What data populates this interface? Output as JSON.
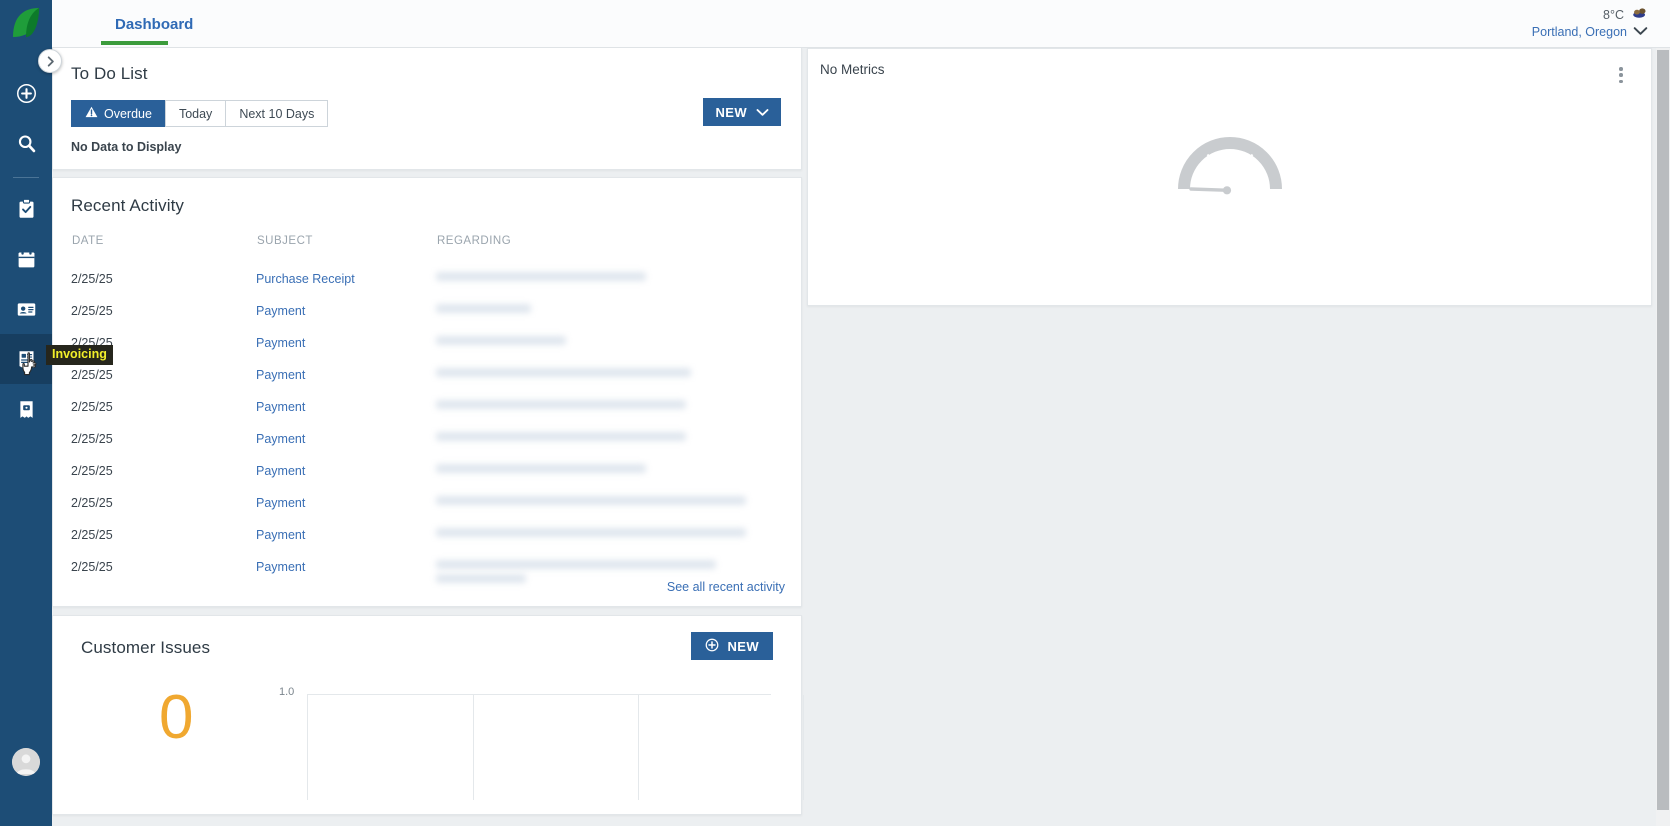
{
  "app": {
    "logo_icon": "leaf-logo-icon",
    "accent_blue": "#2a6099",
    "rail_bg": "#1d4d76",
    "tab_underline_green": "#3c9c3c",
    "link_blue": "#3a6fb5",
    "orange": "#f0a830"
  },
  "rail": {
    "toggle_icon": "chevron-right-icon",
    "items": [
      {
        "icon": "plus-circle-icon",
        "name": "create"
      },
      {
        "icon": "search-icon",
        "name": "search"
      },
      {
        "icon": "clipboard-check-icon",
        "name": "tasks"
      },
      {
        "icon": "calendar-icon",
        "name": "calendar"
      },
      {
        "icon": "contact-card-icon",
        "name": "contacts"
      },
      {
        "icon": "invoice-icon",
        "name": "invoicing"
      },
      {
        "icon": "receipt-icon",
        "name": "receipts"
      }
    ],
    "active_item": "invoicing",
    "tooltip": "Invoicing",
    "avatar_icon": "user-avatar-icon"
  },
  "header": {
    "tab_label": "Dashboard",
    "weather": {
      "temperature": "8°C",
      "icon": "weather-icon",
      "location": "Portland, Oregon",
      "chevron_icon": "chevron-down-icon"
    }
  },
  "todo": {
    "title": "To Do List",
    "filters": [
      {
        "label": "Overdue",
        "selected": true,
        "icon": "warning-triangle-icon"
      },
      {
        "label": "Today",
        "selected": false,
        "icon": ""
      },
      {
        "label": "Next 10 Days",
        "selected": false,
        "icon": ""
      }
    ],
    "new_button": "NEW",
    "new_button_icon": "chevron-down-icon",
    "empty_message": "No Data to Display"
  },
  "recent_activity": {
    "title": "Recent Activity",
    "columns": [
      "DATE",
      "SUBJECT",
      "REGARDING"
    ],
    "rows": [
      {
        "date": "2/25/25",
        "subject": "Purchase Receipt",
        "regarding": "",
        "redacted": true,
        "lines": 1
      },
      {
        "date": "2/25/25",
        "subject": "Payment",
        "regarding": "",
        "redacted": true,
        "lines": 1
      },
      {
        "date": "2/25/25",
        "subject": "Payment",
        "regarding": "",
        "redacted": true,
        "lines": 1
      },
      {
        "date": "2/25/25",
        "subject": "Payment",
        "regarding": "",
        "redacted": true,
        "lines": 1
      },
      {
        "date": "2/25/25",
        "subject": "Payment",
        "regarding": "",
        "redacted": true,
        "lines": 1
      },
      {
        "date": "2/25/25",
        "subject": "Payment",
        "regarding": "",
        "redacted": true,
        "lines": 1
      },
      {
        "date": "2/25/25",
        "subject": "Payment",
        "regarding": "",
        "redacted": true,
        "lines": 1
      },
      {
        "date": "2/25/25",
        "subject": "Payment",
        "regarding": "",
        "redacted": true,
        "lines": 1
      },
      {
        "date": "2/25/25",
        "subject": "Payment",
        "regarding": "",
        "redacted": true,
        "lines": 1
      },
      {
        "date": "2/25/25",
        "subject": "Payment",
        "regarding": "",
        "redacted": true,
        "lines": 2
      }
    ],
    "see_all_link": "See all recent activity"
  },
  "customer_issues": {
    "title": "Customer Issues",
    "new_button": "NEW",
    "new_button_icon": "plus-circle-icon",
    "count": "0",
    "chart_y_top_label": "1.0"
  },
  "metrics": {
    "title": "No Metrics",
    "menu_icon": "kebab-menu-icon",
    "placeholder_icon": "gauge-icon"
  },
  "chart_data": {
    "type": "bar",
    "title": "Customer Issues",
    "categories": [],
    "values": [],
    "series": [
      {
        "name": "Customer Issues",
        "values": []
      }
    ],
    "ylabel": "",
    "xlabel": "",
    "ylim": [
      0,
      1.0
    ],
    "ytick_labels": [
      "1.0"
    ],
    "grid": true,
    "legend": "none",
    "annotation_total": "0"
  }
}
